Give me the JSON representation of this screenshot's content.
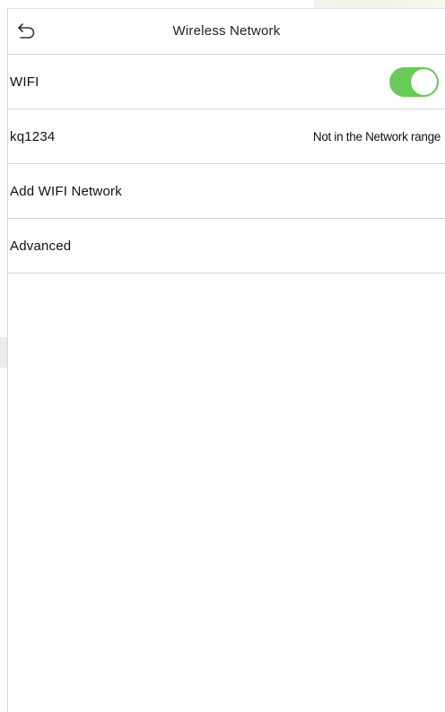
{
  "header": {
    "title": "Wireless Network",
    "back_icon": "back-arrow-icon"
  },
  "settings": {
    "wifi": {
      "label": "WIFI",
      "enabled": true,
      "toggle_color": "#66cc55"
    },
    "network": {
      "ssid": "kq1234",
      "status": "Not in the Network range"
    },
    "add_network": {
      "label": "Add WIFI Network"
    },
    "advanced": {
      "label": "Advanced"
    }
  }
}
